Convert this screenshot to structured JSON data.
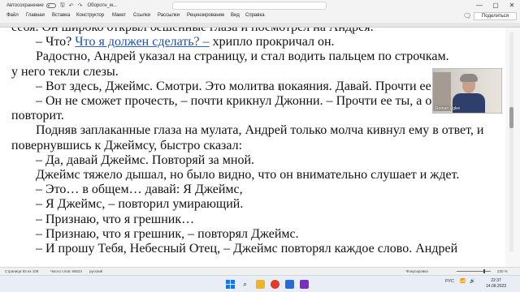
{
  "titlebar": {
    "autosave_label": "Автосохранение",
    "doc_title": "Оборотн_м...",
    "minimize": "—",
    "maximize": "▢",
    "close": "✕"
  },
  "menu": {
    "items": [
      "Файл",
      "Главная",
      "Вставка",
      "Конструктор",
      "Макет",
      "Ссылки",
      "Рассылки",
      "Рецензирование",
      "Вид",
      "Справка"
    ],
    "share_label": "Поделиться"
  },
  "document": {
    "lines": [
      "— Что? Что я должен сделать? – хрипло прокричал он.",
      "Радостно, Андрей указал на страницу, и стал водить пальцем по строчкам.",
      "у него текли слезы.",
      "– Вот здесь, Джеймс. Смотри. Это молитва покаяния. Давай. Прочти ее.",
      "– Он не сможет прочесть, – почти крикнул Джонни. – Прочти ее ты, а он пусть",
      "повторит.",
      "Подняв заплаканные глаза на мулата, Андрей только молча кивнул ему в ответ, и",
      "повернувшись к Джеймсу, быстро сказал:",
      "– Да, давай Джеймс. Повторяй за мной.",
      "Джеймс тяжело дышал, но было видно, что он внимательно слушает и ждет.",
      "– Это… в общем…  давай: Я Джеймс,",
      "– Я Джеймс, – повторил умирающий.",
      "– Признаю, что я грешник…",
      "– Признаю, что я грешник, – повторял Джеймс.",
      "– И прошу Тебя, Небесный Отец, – Джеймс повторял каждое слово. Андрей"
    ],
    "partial_top": "себя. Он широко открыл бешенные глаза и посмотрел на Андрея.",
    "line0_pre": "– Что? ",
    "line0_link": "Что я должен сделать? –",
    "line0_post": " хрипло прокричал он."
  },
  "webcam": {
    "name": "Roman Uglev"
  },
  "statusbar": {
    "page": "Страница 93 из 108",
    "words": "Число слов: 66024",
    "lang": "русский",
    "focus": "Фокусировка",
    "zoom": "230 %",
    "zoom_level": 0.78
  },
  "taskbar": {
    "lang": "РУС",
    "time": "22:37",
    "date": "14.09.2023"
  }
}
